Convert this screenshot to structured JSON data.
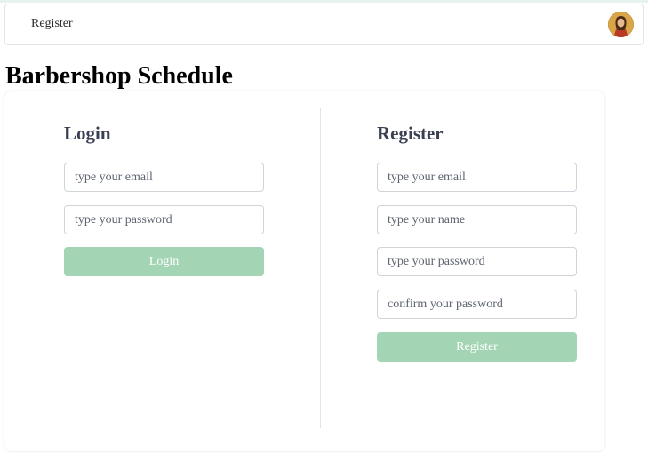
{
  "nav": {
    "register_link": "Register",
    "avatar_icon": "user-avatar-icon"
  },
  "page": {
    "title": "Barbershop Schedule"
  },
  "login": {
    "title": "Login",
    "email_placeholder": "type your email",
    "email_value": "",
    "password_placeholder": "type your password",
    "password_value": "",
    "button_label": "Login"
  },
  "register": {
    "title": "Register",
    "email_placeholder": "type your email",
    "email_value": "",
    "name_placeholder": "type your name",
    "name_value": "",
    "password_placeholder": "type your password",
    "password_value": "",
    "confirm_placeholder": "confirm your password",
    "confirm_value": "",
    "button_label": "Register"
  },
  "colors": {
    "button_bg": "#a3d4b4",
    "button_text": "#ffffff",
    "heading": "#3a3f52",
    "field_border": "#cfd4d9"
  }
}
